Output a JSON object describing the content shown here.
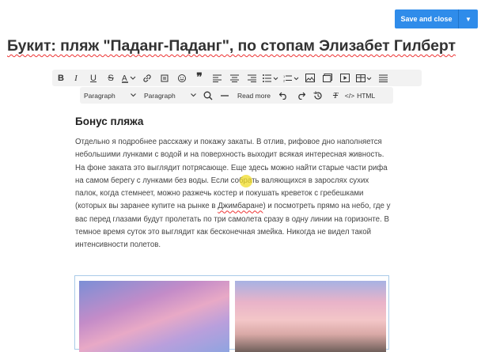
{
  "header": {
    "save_label": "Save and close"
  },
  "article": {
    "title": "Букит: пляж \"Паданг-Паданг\", по стопам Элизабет Гилберт"
  },
  "toolbar2": {
    "paragraph_1": "Paragraph",
    "paragraph_2": "Paragraph",
    "read_more": "Read more",
    "html": "HTML"
  },
  "content": {
    "heading": "Бонус пляжа",
    "body_before": "Отдельно я подробнее расскажу и покажу закаты. В отлив, рифовое дно наполняется небольшими лунками с водой и на поверхность выходит всякая интересная живность. На фоне заката это выглядит потрясающе. Еще здесь можно найти старые части рифа на самом берегу с лунками без воды. Если собрать валяющихся в зарослях сухих палок, когда стемнеет, можно разжечь костер и покушать креветок с гребешками (которых вы заранее купите на рынке в ",
    "misspelled": "Джимбаране",
    "body_after": ") и посмотреть прямо на небо, где у вас перед глазами будут пролетать по три самолета сразу в одну линии на горизонте. В темное время суток это выглядит как бесконечная змейка. Никогда не видел такой интенсивности полетов."
  },
  "colors": {
    "accent": "#2f8cea",
    "toolbar_bg": "#f2f2f2"
  },
  "icons": [
    "bold-icon",
    "italic-icon",
    "underline-icon",
    "strikethrough-icon",
    "text-color-icon",
    "link-icon",
    "emoji-icon",
    "quote-icon",
    "align-left-icon",
    "align-center-icon",
    "align-right-icon",
    "bullet-list-icon",
    "numbered-list-icon",
    "image-icon",
    "gallery-icon",
    "video-icon",
    "table-icon",
    "justify-icon",
    "search-icon",
    "horizontal-line-icon",
    "undo-icon",
    "redo-icon",
    "history-icon",
    "clear-format-icon",
    "code-icon"
  ]
}
